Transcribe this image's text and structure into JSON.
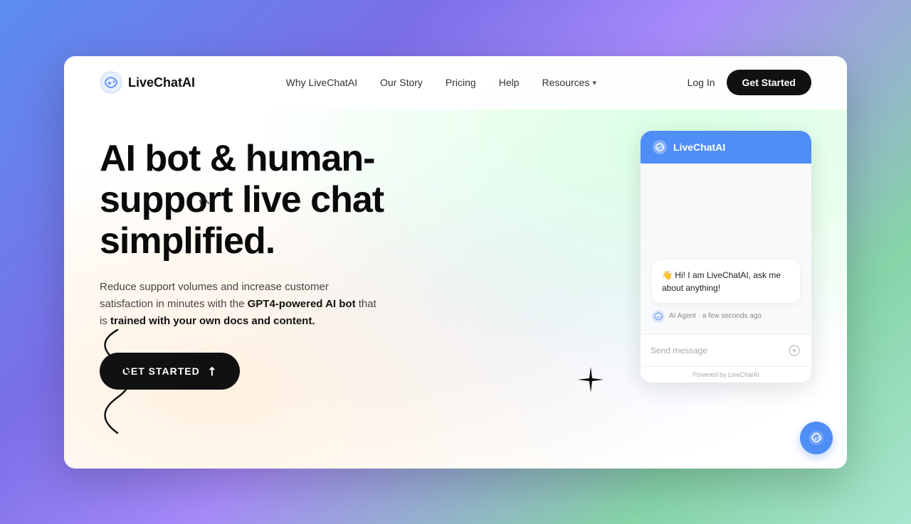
{
  "logo": {
    "text": "LiveChatAI"
  },
  "nav": {
    "links": [
      {
        "label": "Why LiveChatAI",
        "id": "why"
      },
      {
        "label": "Our Story",
        "id": "story"
      },
      {
        "label": "Pricing",
        "id": "pricing"
      },
      {
        "label": "Help",
        "id": "help"
      },
      {
        "label": "Resources",
        "id": "resources",
        "hasDropdown": true
      }
    ],
    "login_label": "Log In",
    "get_started_label": "Get Started"
  },
  "hero": {
    "title": "AI bot & human-support live chat simplified.",
    "description_before_bold": "Reduce support volumes and increase customer satisfaction in minutes with the ",
    "description_bold": "GPT4-powered AI bot",
    "description_after_bold": " that is ",
    "description_bold2": "trained with your own docs and content.",
    "cta_label": "GET STARTED"
  },
  "chat_widget": {
    "header_title": "LiveChatAI",
    "message": "👋 Hi! I am LiveChatAI, ask me about anything!",
    "agent_label": "AI Agent · a few seconds ago",
    "input_placeholder": "Send message",
    "footer_text": "Powered by LiveChatAI"
  },
  "decorations": {
    "star_color": "#0a0a0a",
    "squiggle_color": "#0a0a0a"
  }
}
